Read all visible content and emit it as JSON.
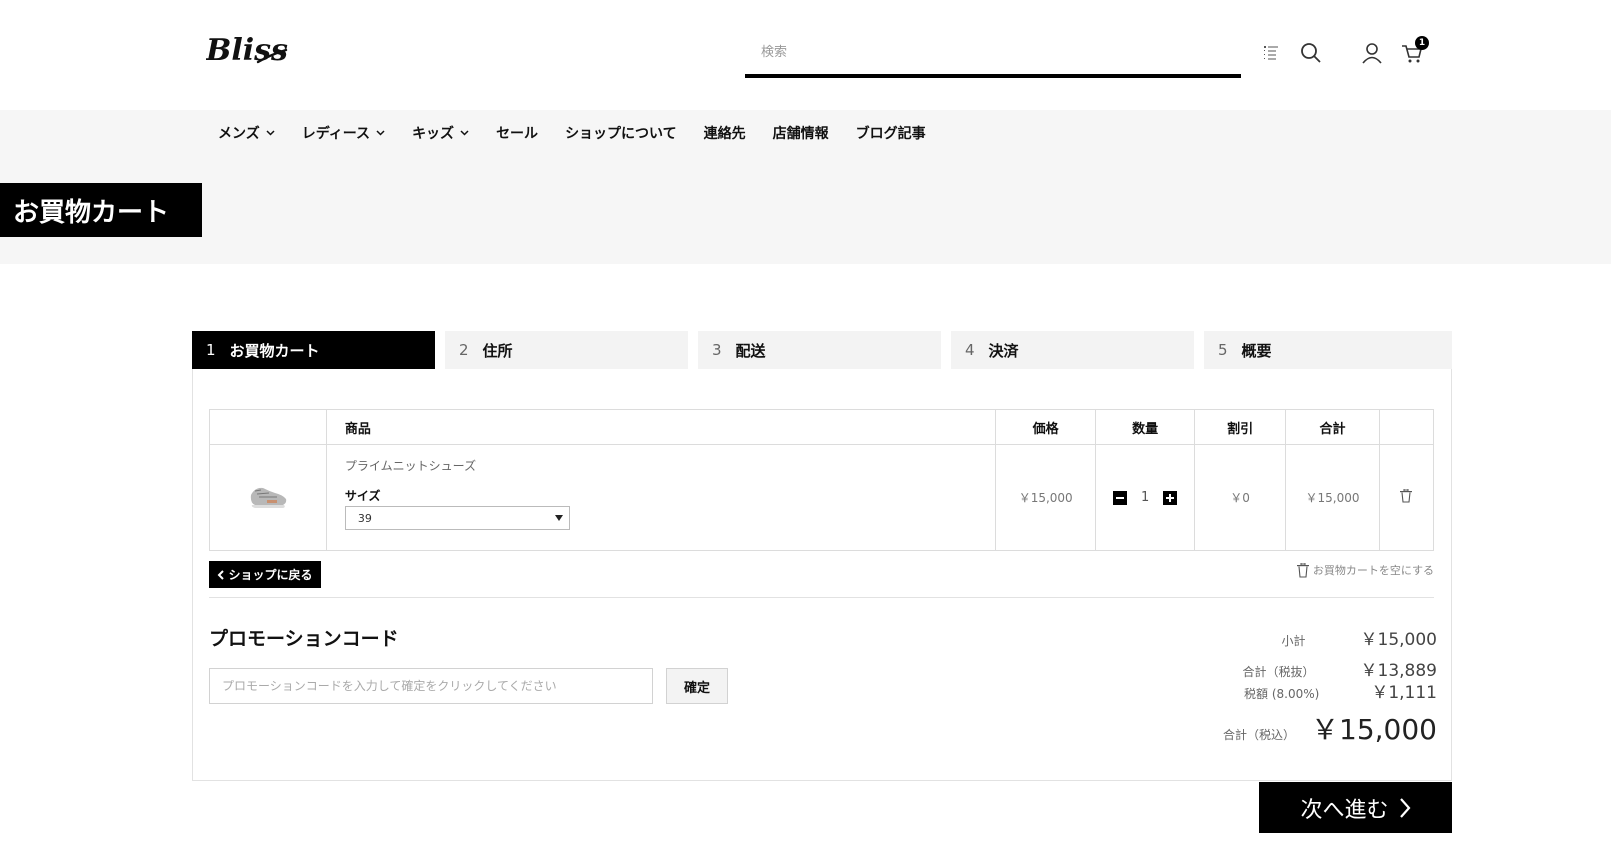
{
  "header": {
    "logo_text": "Bliss",
    "search_placeholder": "検索",
    "cart_count": "1",
    "icons": [
      "list-icon",
      "search-icon",
      "user-icon",
      "cart-icon"
    ]
  },
  "nav": {
    "items": [
      {
        "label": "メンズ",
        "has_dropdown": true
      },
      {
        "label": "レディース",
        "has_dropdown": true
      },
      {
        "label": "キッズ",
        "has_dropdown": true
      },
      {
        "label": "セール",
        "has_dropdown": false
      },
      {
        "label": "ショップについて",
        "has_dropdown": false
      },
      {
        "label": "連絡先",
        "has_dropdown": false
      },
      {
        "label": "店舗情報",
        "has_dropdown": false
      },
      {
        "label": "ブログ記事",
        "has_dropdown": false
      }
    ]
  },
  "page": {
    "title": "お買物カート"
  },
  "steps": [
    {
      "num": "1",
      "label": "お買物カート",
      "active": true
    },
    {
      "num": "2",
      "label": "住所",
      "active": false
    },
    {
      "num": "3",
      "label": "配送",
      "active": false
    },
    {
      "num": "4",
      "label": "決済",
      "active": false
    },
    {
      "num": "5",
      "label": "概要",
      "active": false
    }
  ],
  "cart": {
    "columns": {
      "product": "商品",
      "price": "価格",
      "quantity": "数量",
      "discount": "割引",
      "total": "合計"
    },
    "items": [
      {
        "name": "プライムニットシューズ",
        "size_label": "サイズ",
        "size_value": "39",
        "price": "￥15,000",
        "quantity": "1",
        "discount": "￥0",
        "total": "￥15,000"
      }
    ],
    "back_label": "ショップに戻る",
    "clear_label": "お買物カートを空にする"
  },
  "promo": {
    "title": "プロモーションコード",
    "placeholder": "プロモーションコードを入力して確定をクリックしてください",
    "button": "確定"
  },
  "totals": {
    "subtotal_label": "小計",
    "subtotal_value": "￥15,000",
    "net_label": "合計（税抜）",
    "net_value": "￥13,889",
    "tax_label": "税額 (8.00%)",
    "tax_value": "￥1,111",
    "grand_label": "合計（税込）",
    "grand_value": "￥15,000"
  },
  "next_button": "次へ進む"
}
